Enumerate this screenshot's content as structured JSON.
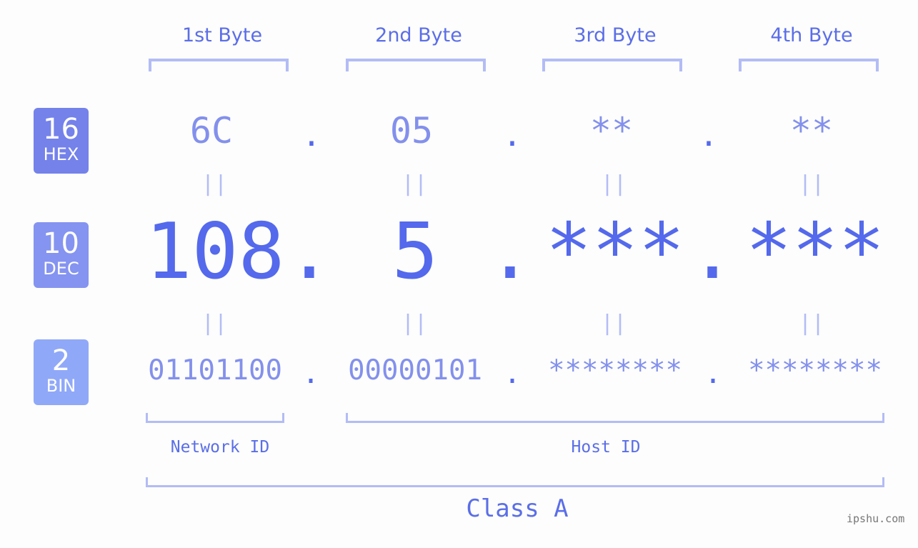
{
  "bytes": [
    {
      "label": "1st Byte",
      "hex": "6C",
      "dec": "108",
      "bin": "01101100"
    },
    {
      "label": "2nd Byte",
      "hex": "05",
      "dec": "5",
      "bin": "00000101"
    },
    {
      "label": "3rd Byte",
      "hex": "**",
      "dec": "***",
      "bin": "********"
    },
    {
      "label": "4th Byte",
      "hex": "**",
      "dec": "***",
      "bin": "********"
    }
  ],
  "separator": ".",
  "equals": "||",
  "badges": {
    "hex": {
      "num": "16",
      "label": "HEX",
      "color": "#7482ea"
    },
    "dec": {
      "num": "10",
      "label": "DEC",
      "color": "#8594f0"
    },
    "bin": {
      "num": "2",
      "label": "BIN",
      "color": "#90a8f8"
    }
  },
  "network_label": "Network ID",
  "host_label": "Host ID",
  "class_label": "Class A",
  "watermark": "ipshu.com"
}
